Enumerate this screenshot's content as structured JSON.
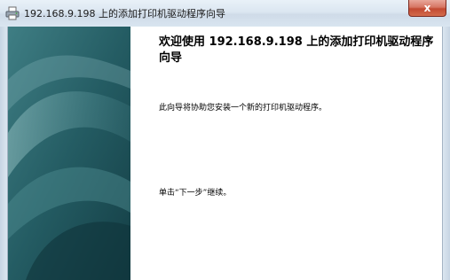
{
  "window": {
    "title": "192.168.9.198 上的添加打印机驱动程序向导",
    "close_glyph": "x",
    "app_icon": "printer-icon"
  },
  "wizard": {
    "heading": "欢迎使用 192.168.9.198 上的添加打印机驱动程序向导",
    "description": "此向导将协助您安装一个新的打印机驱动程序。",
    "hint": "单击“下一步”继续。"
  },
  "colors": {
    "side_panel_dark": "#1d4f57",
    "side_panel_light": "#7fb0b4",
    "close_button": "#c24a32"
  }
}
